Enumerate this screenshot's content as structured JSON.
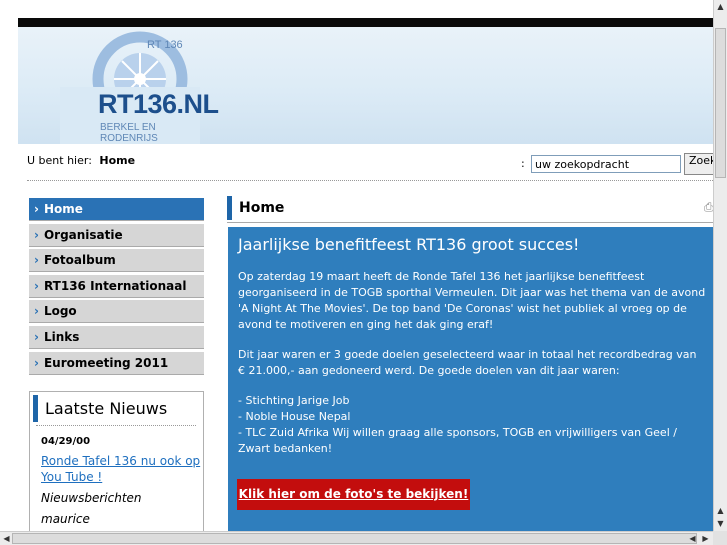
{
  "header": {
    "logo_main": "RT136.NL",
    "logo_sub": "BERKEL EN RODENRIJS",
    "logo_top": "RT 136"
  },
  "breadcrumb": {
    "label": "U bent hier:",
    "current": "Home"
  },
  "search": {
    "label": ":",
    "placeholder": "uw zoekopdracht",
    "value": "uw zoekopdracht",
    "button": "Zoek"
  },
  "nav": {
    "items": [
      {
        "label": "Home",
        "active": true
      },
      {
        "label": "Organisatie"
      },
      {
        "label": "Fotoalbum"
      },
      {
        "label": "RT136 Internationaal"
      },
      {
        "label": "Logo"
      },
      {
        "label": "Links"
      },
      {
        "label": "Euromeeting 2011"
      }
    ]
  },
  "news": {
    "title": "Laatste Nieuws",
    "date": "04/29/00",
    "link": "Ronde Tafel 136 nu ook op You Tube !",
    "category": "Nieuwsberichten",
    "author": "maurice"
  },
  "page": {
    "title": "Home"
  },
  "article": {
    "title": "Jaarlijkse benefitfeest RT136 groot succes!",
    "p1": "Op zaterdag 19 maart heeft de Ronde Tafel 136 het jaarlijkse benefitfeest georganiseerd in de TOGB sporthal Vermeulen. Dit jaar was het thema van de avond 'A Night At The Movies'. De top band  'De Coronas' wist het publiek al vroeg op de avond te motiveren en ging het dak ging eraf!",
    "p2": "Dit jaar waren er 3 goede doelen geselecteerd waar in totaal het recordbedrag van € 21.000,- aan gedoneerd werd. De goede doelen van dit jaar waren:",
    "list1": "- Stichting Jarige Job",
    "list2": "- Noble House Nepal",
    "list3": "- TLC Zuid Afrika Wij willen graag alle sponsors, TOGB en vrijwilligers van Geel / Zwart bedanken!",
    "button": "Klik hier om de foto's te bekijken!"
  },
  "colors": {
    "accent": "#2f7ebd",
    "nav_active": "#2a72b5",
    "button_red": "#c30d0d"
  }
}
